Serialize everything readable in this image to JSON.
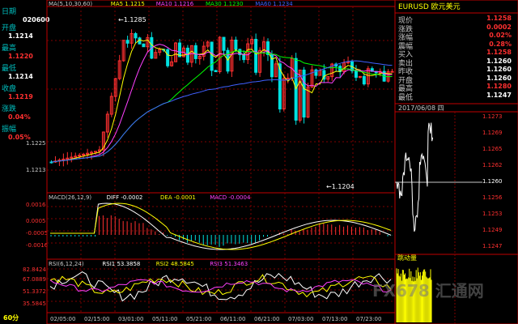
{
  "left": {
    "period_label": "日期",
    "date_value": "020600",
    "rows": [
      {
        "key": "开盘",
        "value": "1.1214",
        "color": "#ffffff"
      },
      {
        "key": "最高",
        "value": "1.1220",
        "color": "#ff3030"
      },
      {
        "key": "最低",
        "value": "1.1214",
        "color": "#ffffff"
      },
      {
        "key": "收盘",
        "value": "1.1219",
        "color": "#ff3030"
      },
      {
        "key": "涨跌",
        "value": "0.04%",
        "color": "#ff3030"
      },
      {
        "key": "振幅",
        "value": "0.05%",
        "color": "#ff3030"
      }
    ],
    "price_ticks": [
      "1.1225",
      "1.1213"
    ],
    "macd_ticks": [
      "0.0016",
      "0.0005",
      "-0.0005",
      "-0.0016"
    ],
    "rsi_ticks": [
      "82.8424",
      "67.0889",
      "51.3372",
      "35.5845"
    ],
    "timeframe": "60分"
  },
  "main": {
    "ma_legend": [
      {
        "text": "MA(5,10,30,60)",
        "color": "#c8c8c8"
      },
      {
        "text": "MA5 1.1215",
        "color": "#ffff00"
      },
      {
        "text": "MA10 1.1216",
        "color": "#ff40ff"
      },
      {
        "text": "MA30 1.1230",
        "color": "#00ff00"
      },
      {
        "text": "MA60 1.1234",
        "color": "#4060ff"
      }
    ],
    "high_label": "←1.1285",
    "low_label": "←1.1204",
    "macd_legend": [
      {
        "text": "MACD(26,12,9)",
        "color": "#c8c8c8"
      },
      {
        "text": "DIFF -0.0002",
        "color": "#ffffff"
      },
      {
        "text": "DEA -0.0001",
        "color": "#ffff00"
      },
      {
        "text": "MACD -0.0004",
        "color": "#ff40ff"
      }
    ],
    "rsi_legend": [
      {
        "text": "RSI(6,12,24)",
        "color": "#c8c8c8"
      },
      {
        "text": "RSI1 53.3858",
        "color": "#ffffff"
      },
      {
        "text": "RSI2 48.5845",
        "color": "#ffff00"
      },
      {
        "text": "RSI3 51.3463",
        "color": "#ff40ff"
      }
    ],
    "x_labels": [
      "02/05:00",
      "02/15:00",
      "03/01:00",
      "05/11:00",
      "05/21:00",
      "06/11:00",
      "06/21:00",
      "07/03:00",
      "07/13:00",
      "07/23:00"
    ]
  },
  "right": {
    "symbol": "EURUSD 欧元美元",
    "quote_rows": [
      {
        "key": "现价",
        "value": "1.1258",
        "color": "#ff3030"
      },
      {
        "key": "涨跌",
        "value": "0.0002",
        "color": "#ff3030"
      },
      {
        "key": "涨幅",
        "value": "0.02%",
        "color": "#ff3030"
      },
      {
        "key": "震幅",
        "value": "0.28%",
        "color": "#ff3030"
      },
      {
        "key": "买入",
        "value": "1.1258",
        "color": "#ff3030"
      },
      {
        "key": "卖出",
        "value": "1.1260",
        "color": "#ffffff"
      },
      {
        "key": "昨收",
        "value": "1.1260",
        "color": "#ffffff"
      },
      {
        "key": "开盘",
        "value": "1.1260",
        "color": "#ffffff"
      },
      {
        "key": "最高",
        "value": "1.1280",
        "color": "#ff3030"
      },
      {
        "key": "最低",
        "value": "1.1247",
        "color": "#ffffff"
      }
    ],
    "date_label": "2017/06/08 四",
    "tick_labels": [
      "1.1273",
      "1.1269",
      "1.1265",
      "1.1262",
      "1.1260",
      "1.1256",
      "1.1253",
      "1.1249",
      "1.1247"
    ],
    "volume_label": "跳动量",
    "current_line_label": "1.1260"
  },
  "watermark": "FX678 汇通网",
  "colors": {
    "up": "#ff3030",
    "down": "#00e0e0",
    "grid": "#800000",
    "axis": "#c00000"
  }
}
